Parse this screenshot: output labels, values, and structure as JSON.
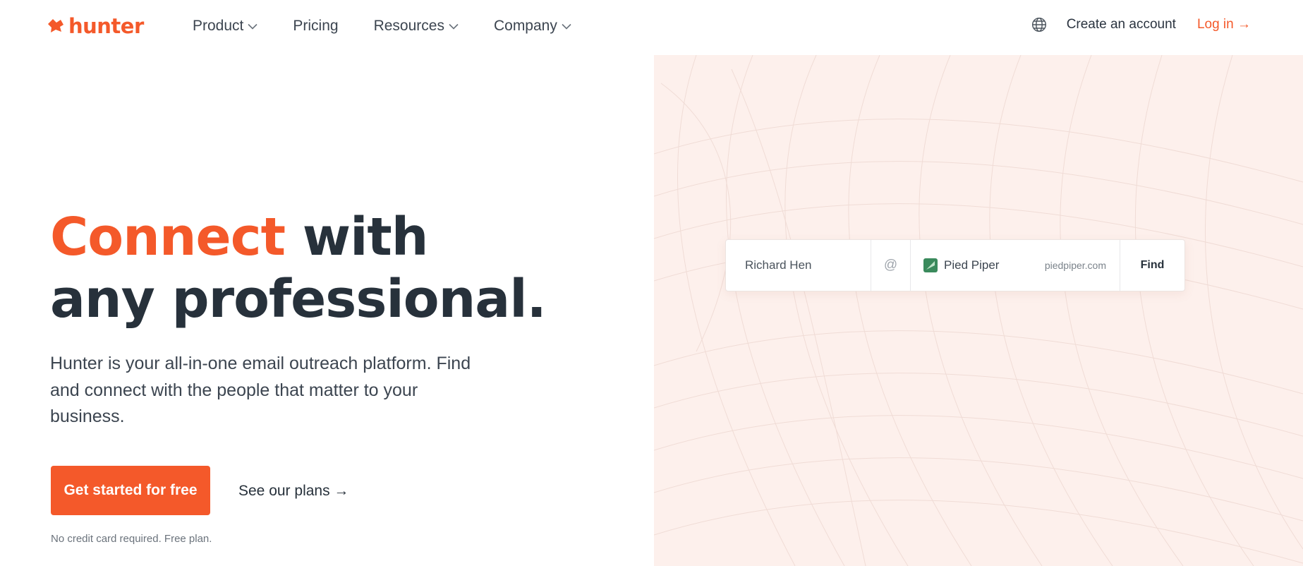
{
  "brand": {
    "name": "hunter",
    "color": "#f4592a"
  },
  "nav": {
    "items": [
      {
        "label": "Product",
        "has_dropdown": true
      },
      {
        "label": "Pricing",
        "has_dropdown": false
      },
      {
        "label": "Resources",
        "has_dropdown": true
      },
      {
        "label": "Company",
        "has_dropdown": true
      }
    ]
  },
  "header": {
    "language_icon": "globe-icon",
    "create_account_label": "Create an account",
    "login_label": "Log in →"
  },
  "hero": {
    "headline_accent": "Connect",
    "headline_rest_line1": " with",
    "headline_line2": "any professional.",
    "subtext": "Hunter is your all-in-one email outreach platform. Find and connect with the people that matter to your business.",
    "cta_primary_label": "Get started for free",
    "cta_secondary_label": "See our plans →",
    "note": "No credit card required. Free plan."
  },
  "finder": {
    "name_value": "Richard Hen",
    "at_symbol": "@",
    "company_name": "Pied Piper",
    "company_domain": "piedpiper.com",
    "company_icon": "pied-piper-logo-icon",
    "find_label": "Find"
  },
  "colors": {
    "accent": "#f4592a",
    "text_dark": "#27313b",
    "panel_bg": "#fdf0ec",
    "company_icon_green": "#3a8a5c"
  }
}
